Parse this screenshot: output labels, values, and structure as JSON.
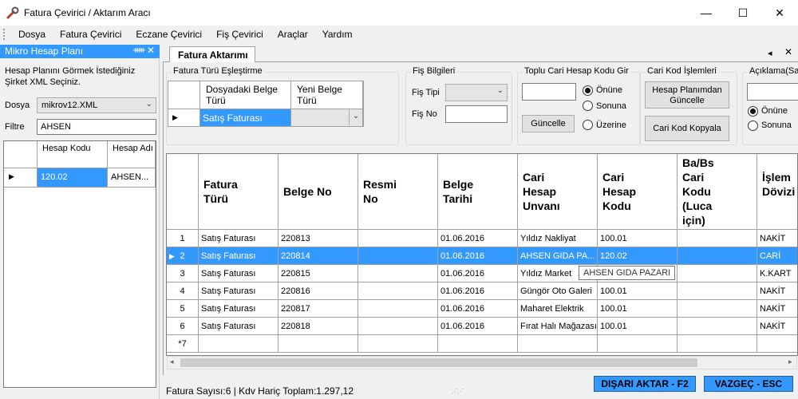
{
  "window": {
    "title": "Fatura Çevirici / Aktarım Aracı",
    "minimize_glyph": "—",
    "maximize_glyph": "☐",
    "close_glyph": "✕"
  },
  "menu": [
    "Dosya",
    "Fatura Çevirici",
    "Eczane Çevirici",
    "Fiş Çevirici",
    "Araçlar",
    "Yardım"
  ],
  "left_panel": {
    "title": "Mikro Hesap Planı",
    "pin_glyph": "📌",
    "close_glyph": "✕",
    "info": "Hesap Planını Görmek İstediğiniz Şirket XML Seçiniz.",
    "dosya_label": "Dosya",
    "dosya_value": "mikrov12.XML",
    "filtre_label": "Filtre",
    "filtre_value": "AHSEN",
    "grid": {
      "headers": [
        "Hesap Kodu",
        "Hesap Adı"
      ],
      "rows": [
        {
          "kod": "120.02",
          "ad": "AHSEN..."
        }
      ]
    }
  },
  "tab": {
    "label": "Fatura Aktarımı",
    "close_glyph": "✕"
  },
  "fatura_turu": {
    "title": "Fatura Türü Eşleştirme",
    "headers": [
      "Dosyadaki Belge Türü",
      "Yeni Belge Türü"
    ],
    "row_value": "Satış Faturası",
    "new_value": ""
  },
  "fis_bilgileri": {
    "title": "Fiş Bilgileri",
    "fis_tipi_label": "Fiş Tipi",
    "fis_tipi_value": "",
    "fis_no_label": "Fiş No",
    "fis_no_value": ""
  },
  "toplu_cari": {
    "title": "Toplu Cari Hesap Kodu Gir",
    "input_value": "",
    "button": "Güncelle",
    "options": [
      "Önüne",
      "Sonuna",
      "Üzerine"
    ],
    "selected": "Önüne"
  },
  "cari_kod": {
    "title": "Cari Kod İşlemleri",
    "button1": "Hesap Planımdan Güncelle",
    "button2": "Cari Kod Kopyala"
  },
  "aciklama": {
    "title": "Açıklama(Sat",
    "input_value": "",
    "options": [
      "Önüne",
      "Sonuna"
    ],
    "selected": "Önüne"
  },
  "main_grid": {
    "headers": [
      "Fatura Türü",
      "Belge No",
      "Resmi No",
      "Belge Tarihi",
      "Cari Hesap Unvanı",
      "Cari Hesap Kodu",
      "Ba/Bs Cari Kodu (Luca için)",
      "İşlem Dövizi"
    ],
    "rows": [
      {
        "n": "1",
        "tur": "Satış Faturası",
        "belge": "220813",
        "resmi": "",
        "tarih": "01.06.2016",
        "unvan": "Yıldız Nakliyat",
        "kod": "100.01",
        "babs": "",
        "doviz": "NAKİT"
      },
      {
        "n": "2",
        "tur": "Satış Faturası",
        "belge": "220814",
        "resmi": "",
        "tarih": "01.06.2016",
        "unvan": "AHSEN GIDA PA...",
        "kod": "120.02",
        "babs": "",
        "doviz": "CARİ"
      },
      {
        "n": "3",
        "tur": "Satış Faturası",
        "belge": "220815",
        "resmi": "",
        "tarih": "01.06.2016",
        "unvan": "Yıldız Market",
        "kod": "",
        "babs": "",
        "doviz": "K.KART"
      },
      {
        "n": "4",
        "tur": "Satış Faturası",
        "belge": "220816",
        "resmi": "",
        "tarih": "01.06.2016",
        "unvan": "Güngör Oto Galeri",
        "kod": "100.01",
        "babs": "",
        "doviz": "NAKİT"
      },
      {
        "n": "5",
        "tur": "Satış Faturası",
        "belge": "220817",
        "resmi": "",
        "tarih": "01.06.2016",
        "unvan": "Maharet Elektrik",
        "kod": "100.01",
        "babs": "",
        "doviz": "NAKİT"
      },
      {
        "n": "6",
        "tur": "Satış Faturası",
        "belge": "220818",
        "resmi": "",
        "tarih": "01.06.2016",
        "unvan": "Fırat Halı Mağazası",
        "kod": "100.01",
        "babs": "",
        "doviz": "NAKİT"
      }
    ],
    "new_row_marker": "*7",
    "tooltip": "AHSEN GIDA PAZARI",
    "selected_row": "2"
  },
  "status": "Fatura Sayısı:6 | Kdv Hariç Toplam:1.297,12",
  "buttons": {
    "export": "DIŞARI AKTAR - F2",
    "cancel": "VAZGEÇ - ESC"
  },
  "colors": {
    "selection": "#3399ff",
    "window_bg": "#f0f0f0"
  }
}
